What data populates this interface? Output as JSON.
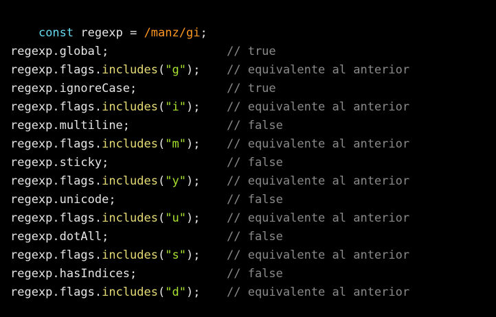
{
  "code": {
    "declaration": {
      "keyword": "const",
      "name": "regexp",
      "operator": "=",
      "regex": "/manz/gi",
      "terminator": ";"
    },
    "object": "regexp",
    "flags_prop": "flags",
    "method": "includes",
    "lines": [
      {
        "property": "global"
      },
      {
        "flag": "\"g\""
      },
      {
        "property": "ignoreCase"
      },
      {
        "flag": "\"i\""
      },
      {
        "property": "multiline"
      },
      {
        "flag": "\"m\""
      },
      {
        "property": "sticky"
      },
      {
        "flag": "\"y\""
      },
      {
        "property": "unicode"
      },
      {
        "flag": "\"u\""
      },
      {
        "property": "dotAll"
      },
      {
        "flag": "\"s\""
      },
      {
        "property": "hasIndices"
      },
      {
        "flag": "\"d\""
      }
    ],
    "comments": [
      "// true",
      "// equivalente al anterior",
      "// true",
      "// equivalente al anterior",
      "// false",
      "// equivalente al anterior",
      "// false",
      "// equivalente al anterior",
      "// false",
      "// equivalente al anterior",
      "// false",
      "// equivalente al anterior",
      "// false",
      "// equivalente al anterior"
    ]
  },
  "colors": {
    "background": "#000000",
    "keyword": "#66d9ef",
    "regex": "#fd971f",
    "method": "#e6db74",
    "string": "#a6e22e",
    "comment": "#8a8a8a",
    "text": "#e6e6e6"
  }
}
